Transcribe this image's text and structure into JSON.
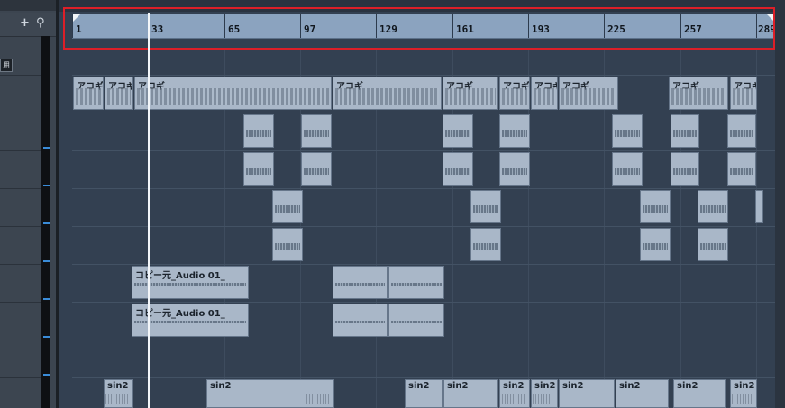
{
  "toolbar": {
    "add_icon": "+",
    "search_icon": "⚲",
    "mini_tag": "用"
  },
  "ruler": {
    "labels": [
      "1",
      "33",
      "65",
      "97",
      "129",
      "161",
      "193",
      "225",
      "257",
      "289"
    ]
  },
  "tracks": {
    "acoustic_label": "アコギ",
    "copy_label": "コピー元_Audio 01_",
    "sin_label": "sin2"
  },
  "colors": {
    "ruler": "#8ba3bf",
    "event": "#a9b7c8",
    "highlight": "#dd1f28",
    "background": "#334051"
  }
}
